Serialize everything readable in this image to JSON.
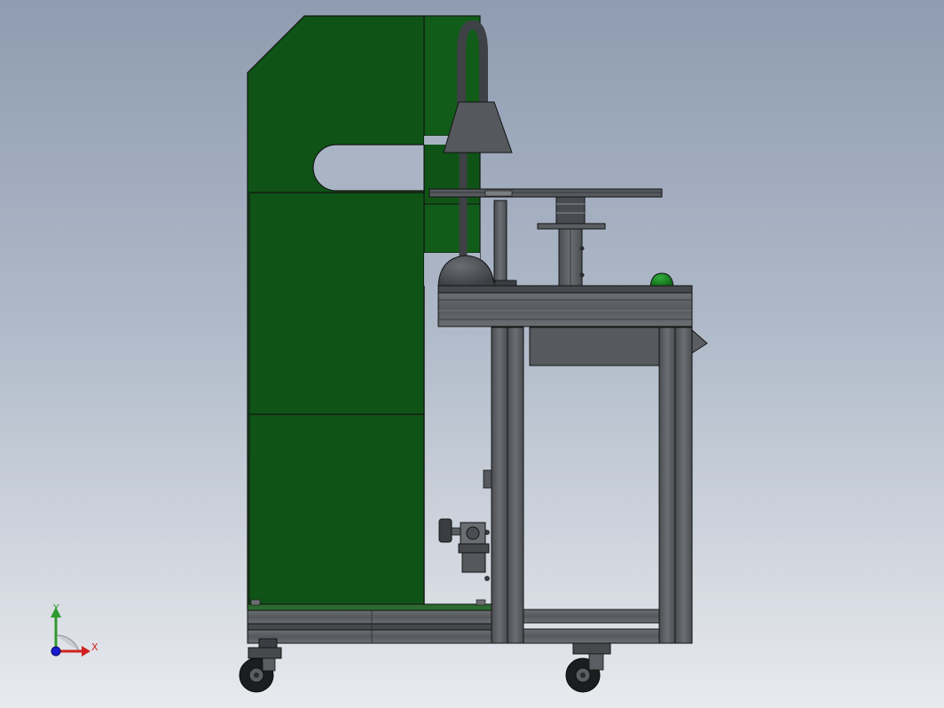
{
  "triad": {
    "x_label": "X",
    "y_label": "Y",
    "x_color": "#d02020",
    "y_color": "#2f9a2f",
    "z_color": "#1a1ad0"
  },
  "colors": {
    "background_top": "#8f9cb1",
    "background_bottom": "#e8eaee",
    "enclosure_green": "#0f5416",
    "frame_gray": "#5c5f63",
    "edge_black": "#141414"
  },
  "scene": {
    "components": [
      "green-enclosure",
      "desk-lamp",
      "fixture-plate",
      "workbench-frame",
      "green-button",
      "pressure-regulator",
      "caster-wheels"
    ]
  }
}
